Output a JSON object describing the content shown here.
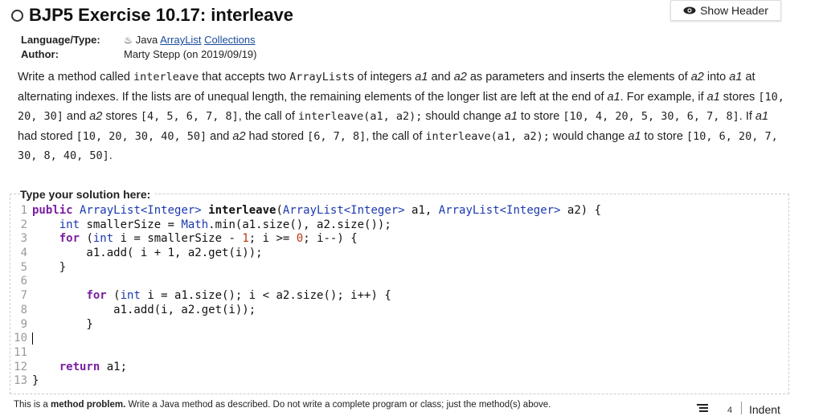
{
  "header": {
    "title": "BJP5 Exercise 10.17: interleave",
    "show_header_label": "Show Header"
  },
  "meta": {
    "language_label": "Language/Type:",
    "language_value": "Java",
    "link1": "ArrayList",
    "link2": "Collections",
    "author_label": "Author:",
    "author_value": "Marty Stepp (on 2019/09/19)"
  },
  "description": {
    "s1": "Write a method called ",
    "c1": "interleave",
    "s2": " that accepts two ",
    "c2": "ArrayList",
    "s3": "s of integers ",
    "i1": "a1",
    "s4": " and ",
    "i2": "a2",
    "s5": " as parameters and inserts the elements of ",
    "i3": "a2",
    "s6": " into ",
    "i4": "a1",
    "s7": " at alternating indexes. If the lists are of unequal length, the remaining elements of the longer list are left at the end of ",
    "i5": "a1",
    "s8": ". For example, if ",
    "i6": "a1",
    "s9": " stores ",
    "c3": "[10, 20, 30]",
    "s10": " and ",
    "i7": "a2",
    "s11": " stores ",
    "c4": "[4, 5, 6, 7, 8]",
    "s12": ", the call of ",
    "c5": "interleave(a1, a2);",
    "s13": " should change ",
    "i8": "a1",
    "s14": " to store ",
    "c6": "[10, 4, 20, 5, 30, 6, 7, 8]",
    "s15": ". If ",
    "i9": "a1",
    "s16": " had stored ",
    "c7": "[10, 20, 30, 40, 50]",
    "s17": " and ",
    "i10": "a2",
    "s18": " had stored ",
    "c8": "[6, 7, 8]",
    "s19": ", the call of ",
    "c9": "interleave(a1, a2);",
    "s20": " would change ",
    "i11": "a1",
    "s21": " to store ",
    "c10": "[10, 6, 20, 7, 30, 8, 40, 50]",
    "s22": "."
  },
  "solution": {
    "label": "Type your solution here:",
    "line_numbers": [
      "1",
      "2",
      "3",
      "4",
      "5",
      "6",
      "7",
      "8",
      "9",
      "10",
      "11",
      "12",
      "13"
    ],
    "code": {
      "l1_kw": "public ",
      "l1_type1": "ArrayList<Integer>",
      "l1_fn": " interleave",
      "l1_a": "(",
      "l1_type2": "ArrayList<Integer>",
      "l1_b": " a1, ",
      "l1_type3": "ArrayList<Integer>",
      "l1_c": " a2) {",
      "l2_indent": "    ",
      "l2_kw": "int",
      "l2_a": " smallerSize = ",
      "l2_type": "Math",
      "l2_b": ".min(a1.size(), a2.size());",
      "l3_indent": "    ",
      "l3_kw": "for",
      "l3_a": " (",
      "l3_kw2": "int",
      "l3_b": " i = smallerSize - ",
      "l3_num1": "1",
      "l3_c": "; i >= ",
      "l3_num2": "0",
      "l3_d": "; i--) {",
      "l4": "        a1.add( i + 1, a2.get(i));",
      "l5": "    }",
      "l6": "",
      "l7_indent": "        ",
      "l7_kw": "for",
      "l7_a": " (",
      "l7_kw2": "int",
      "l7_b": " i = a1.size(); i < a2.size(); i++) {",
      "l8": "            a1.add(i, a2.get(i));",
      "l9": "        }",
      "l10": "",
      "l11": "",
      "l12_indent": "    ",
      "l12_kw": "return",
      "l12_a": " a1;",
      "l13": "}"
    }
  },
  "footer": {
    "s1": "This is a ",
    "b1": "method problem.",
    "s2": " Write a Java method as described. Do not write a complete program or class; just the method(s) above.",
    "indent_count": "4",
    "indent_label": "Indent"
  }
}
